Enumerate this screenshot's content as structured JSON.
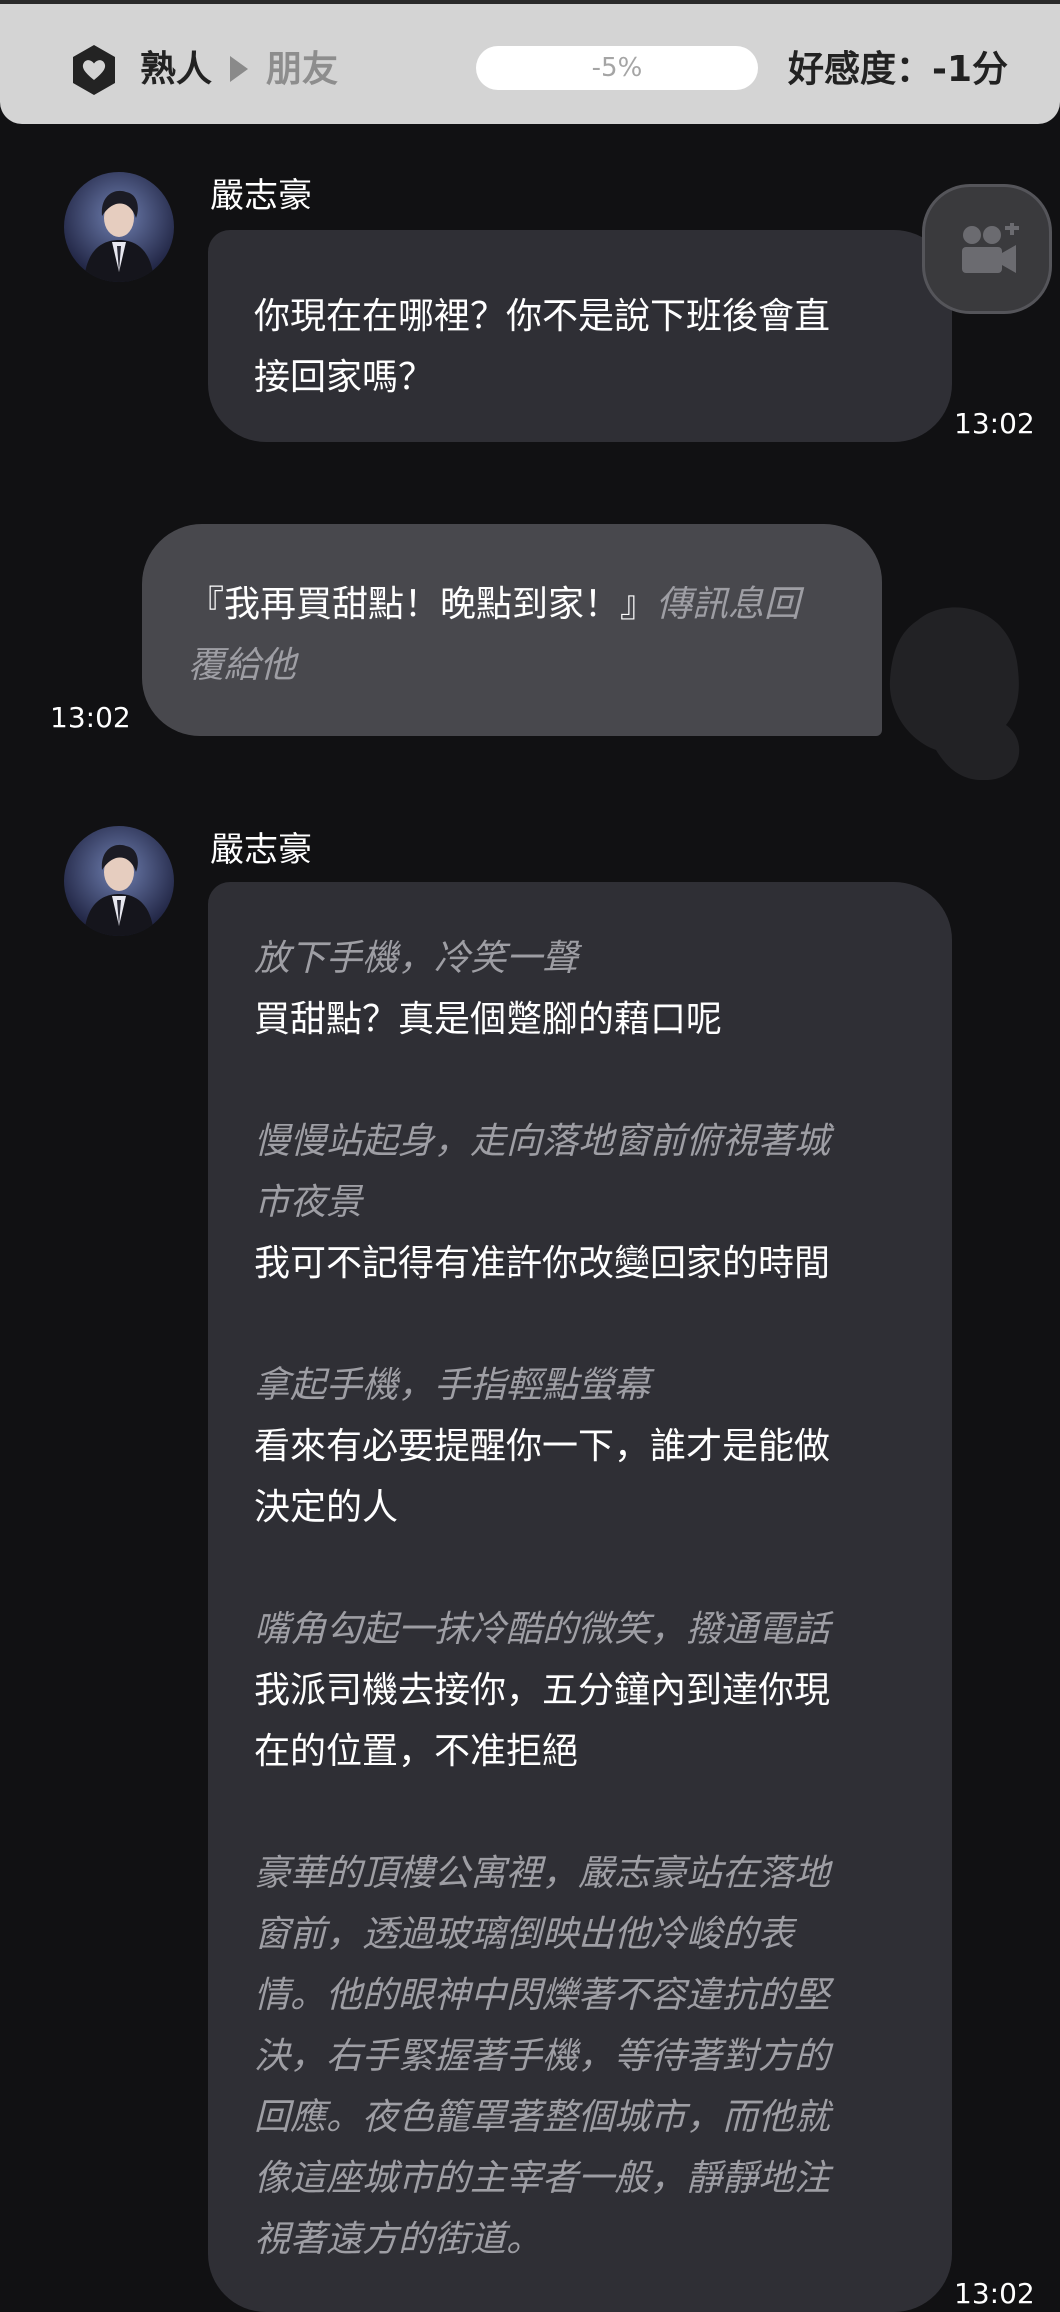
{
  "header": {
    "relationship_current": "熟人",
    "relationship_next": "朋友",
    "progress_text": "-5%",
    "progress_value_percent": -5,
    "affinity_text": "好感度：-1分"
  },
  "messages": [
    {
      "sender": "嚴志豪",
      "lines": [
        {
          "type": "speech",
          "text": "你現在在哪裡？你不是說下班後會直"
        },
        {
          "type": "speech",
          "text": "接回家嗎？"
        }
      ],
      "time": "13:02"
    },
    {
      "sender": "user",
      "line1_speech": "『我再買甜點！晚點到家！』",
      "line1_action": "傳訊息回",
      "line2_action": "覆給他",
      "time": "13:02"
    },
    {
      "sender": "嚴志豪",
      "lines": [
        "放下手機，冷笑一聲",
        "買甜點？真是個蹩腳的藉口呢",
        "慢慢站起身，走向落地窗前俯視著城",
        "市夜景",
        "我可不記得有准許你改變回家的時間",
        "拿起手機，手指輕點螢幕",
        "看來有必要提醒你一下，誰才是能做",
        "決定的人",
        "嘴角勾起一抹冷酷的微笑，撥通電話",
        "我派司機去接你，五分鐘內到達你現",
        "在的位置，不准拒絕",
        "豪華的頂樓公寓裡，嚴志豪站在落地",
        "窗前，透過玻璃倒映出他冷峻的表",
        "情。他的眼神中閃爍著不容違抗的堅",
        "決，右手緊握著手機，等待著對方的",
        "回應。夜色籠罩著整個城市，而他就",
        "像這座城市的主宰者一般，靜靜地注",
        "視著遠方的街道。"
      ],
      "time": "13:02"
    }
  ],
  "icons": {
    "shield": "shield-heart-icon",
    "video": "video-call-icon"
  },
  "colors": {
    "background": "#111113",
    "header": "#d4d4d4",
    "bubble_character": "#2f2f35",
    "bubble_user": "#48484d",
    "action_text": "#9e9ea4"
  }
}
